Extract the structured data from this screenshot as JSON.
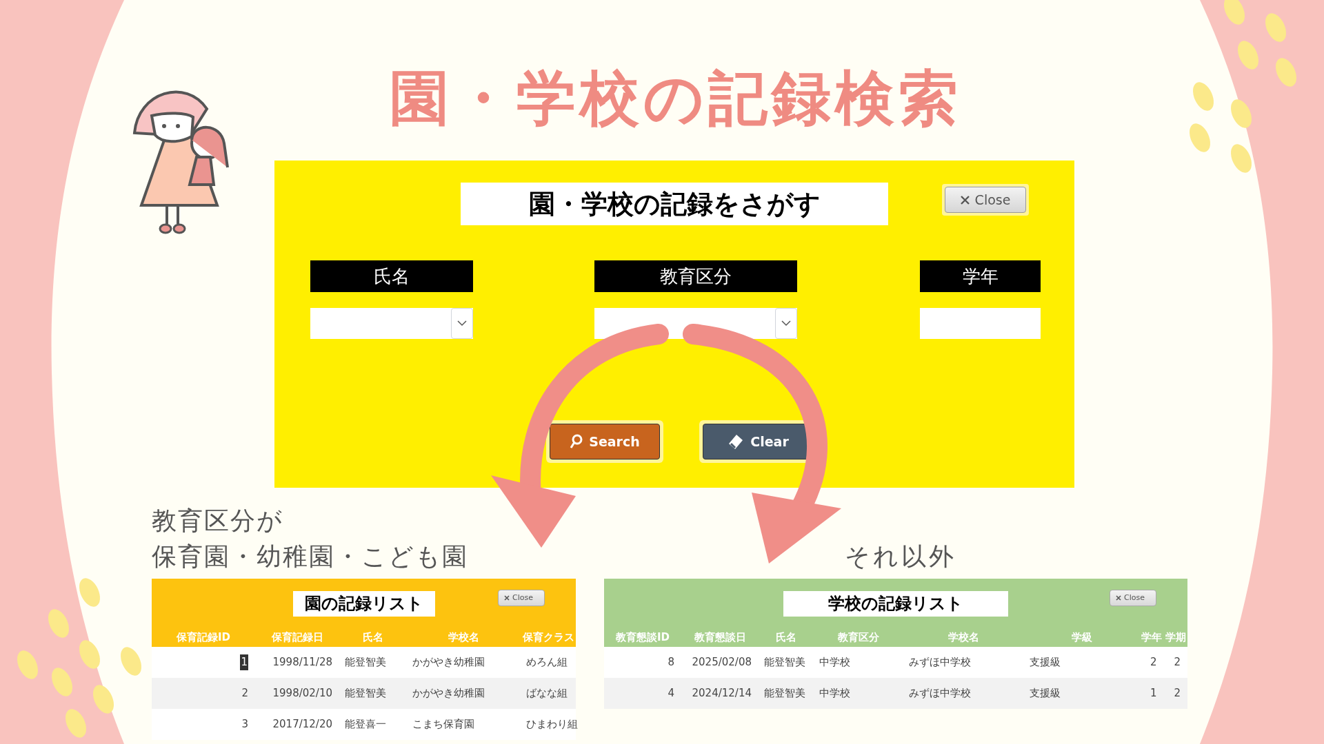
{
  "page_title": "園・学校の記録検索",
  "search_form": {
    "title": "園・学校の記録をさがす",
    "close_button": "Close",
    "fields": [
      {
        "label": "氏名",
        "kind": "combobox"
      },
      {
        "label": "教育区分",
        "kind": "combobox"
      },
      {
        "label": "学年",
        "kind": "text"
      }
    ],
    "buttons": [
      {
        "label": "Search",
        "kind": "search"
      },
      {
        "label": "Clear",
        "kind": "clear"
      }
    ]
  },
  "captions": {
    "left": [
      "教育区分が",
      "保育園・幼稚園・こども園"
    ],
    "right": "それ以外"
  },
  "lists": [
    {
      "title": "園の記録リスト",
      "color": "#fdc30f",
      "close_button": "Close",
      "columns": [
        "保育記録ID",
        "保育記録日",
        "氏名",
        "学校名",
        "保育クラス"
      ],
      "rows": [
        {
          "selected": true,
          "cells": [
            "1",
            "1998/11/28",
            "能登智美",
            "かがやき幼稚園",
            "めろん組"
          ]
        },
        {
          "selected": false,
          "cells": [
            "2",
            "1998/02/10",
            "能登智美",
            "かがやき幼稚園",
            "ばなな組"
          ]
        },
        {
          "selected": false,
          "cells": [
            "3",
            "2017/12/20",
            "能登喜一",
            "こまち保育園",
            "ひまわり組"
          ]
        }
      ]
    },
    {
      "title": "学校の記録リスト",
      "color": "#a8d08d",
      "close_button": "Close",
      "columns": [
        "教育懇談ID",
        "教育懇談日",
        "氏名",
        "教育区分",
        "学校名",
        "学級",
        "学年",
        "学期"
      ],
      "rows": [
        {
          "selected": false,
          "cells": [
            "8",
            "2025/02/08",
            "能登智美",
            "中学校",
            "みずほ中学校",
            "支援級",
            "2",
            "2"
          ]
        },
        {
          "selected": false,
          "cells": [
            "4",
            "2024/12/14",
            "能登智美",
            "中学校",
            "みずほ中学校",
            "支援級",
            "1",
            "2"
          ]
        }
      ]
    }
  ]
}
